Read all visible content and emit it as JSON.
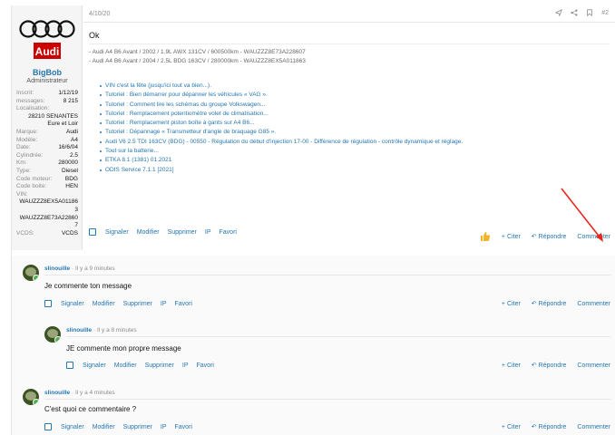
{
  "post": {
    "date": "4/10/20",
    "number": "#2",
    "body": "Ok",
    "user": {
      "name": "BigBob",
      "title": "Administrateur",
      "stats": [
        {
          "k": "Inscrit:",
          "v": "1/12/19"
        },
        {
          "k": "messages:",
          "v": "8 215"
        },
        {
          "k": "Localisation:",
          "v": ""
        },
        {
          "k": "",
          "v": "28210 SENANTES"
        },
        {
          "k": "",
          "v": "Eure et Loir"
        },
        {
          "k": "Marque:",
          "v": "Audi"
        },
        {
          "k": "Modèle:",
          "v": "A4"
        },
        {
          "k": "Date:",
          "v": "16/6/04"
        },
        {
          "k": "Cylindrée:",
          "v": "2.5"
        },
        {
          "k": "Km:",
          "v": "280000"
        },
        {
          "k": "Type:",
          "v": "Diesel"
        },
        {
          "k": "Code moteur:",
          "v": "BDG"
        },
        {
          "k": "Code boite:",
          "v": "HEN"
        },
        {
          "k": "VIN:",
          "v": ""
        }
      ],
      "vin1": "WAUZZZ8EX5A01186",
      "vin1b": "3",
      "vin2": "WAUZZZ8E73A22860",
      "vin2b": "7",
      "vcds_k": "VCDS:",
      "vcds_v": "VCDS"
    },
    "signatures": [
      "- Audi A4 B6 Avant / 2002 / 1.9L AWX 131CV / 600500km - WAUZZZ8E73A228607",
      "- Audi A4 B6 Avant / 2004 / 2.5L BDG 163CV / 280000km - WAUZZZ8EX5A011863"
    ],
    "links": [
      "VIN c'est la fête (jusqu'ici tout va bien...).",
      "Tutoriel : Bien démarrer pour dépanner les véhicules « VAG ».",
      "Tutoriel : Comment lire les schémas du groupe Volkswagen...",
      "Tutoriel : Remplacement potentiomètre volet de climatisation...",
      "Tutoriel : Remplacement piston boîte à gants sur A4 B6...",
      "Tutoriel : Dépannage « Transmetteur d'angle de braquage G85 ».",
      "Audi V6 2.5 TDI 163CV (BDG) - 00550 - Régulation du début d'injection 17-00 - Différence de régulation - contrôle dynamique et réglage.",
      "Tout sur la batterie...",
      "ETKA 8.1 (1381) 01.2021",
      "ODIS Service 7.1.1 [2021]"
    ],
    "actions": {
      "report": "Signaler",
      "edit": "Modifier",
      "delete": "Supprimer",
      "ip": "IP",
      "fav": "Favori"
    },
    "right": {
      "quote": "Citer",
      "reply": "Répondre",
      "comment": "Commenter"
    }
  },
  "comments": [
    {
      "user": "slinouille",
      "time": "Il y a 9 minutes",
      "body": "Je commente ton message"
    },
    {
      "user": "slinouille",
      "time": "Il y a 8 minutes",
      "body": "JE commente mon propre message"
    },
    {
      "user": "slinouille",
      "time": "Il y a 4 minutes",
      "body": "C'est quoi ce commentaire ?"
    }
  ],
  "comment_actions": {
    "report": "Signaler",
    "edit": "Modifier",
    "delete": "Supprimer",
    "ip": "IP",
    "fav": "Favori",
    "quote": "Citer",
    "reply": "Répondre",
    "comment": "Commenter"
  },
  "colors": {
    "link": "#2577b1",
    "arrow": "#e8261c"
  }
}
